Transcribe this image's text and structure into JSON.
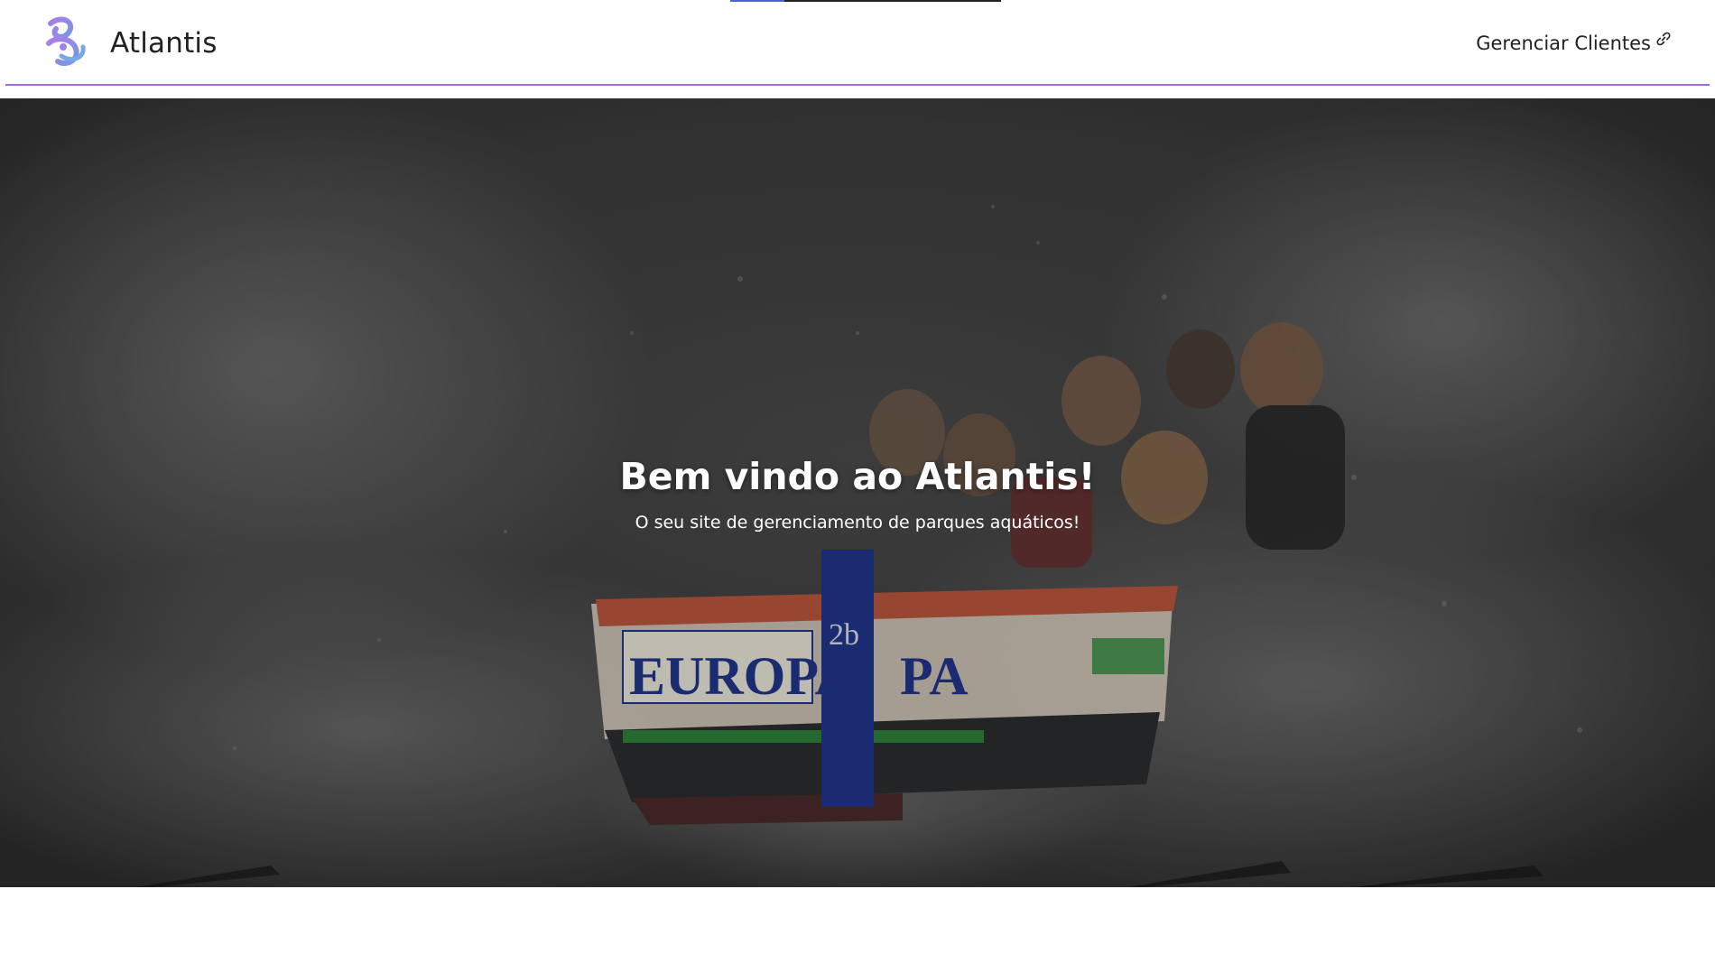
{
  "header": {
    "brand_name": "Atlantis",
    "logo_icon": "atlantis-wave-logo",
    "nav_link_label": "Gerenciar Clientes",
    "nav_link_icon": "link-icon",
    "accent_color": "#a06bea"
  },
  "hero": {
    "title": "Bem vindo ao Atlantis!",
    "subtitle": "O seu site de gerenciamento de parques aquáticos!",
    "background_image": "water-ride-boat-splash",
    "boat_text_left": "EUROPA",
    "boat_text_right": "PA",
    "boat_number": "2b"
  }
}
